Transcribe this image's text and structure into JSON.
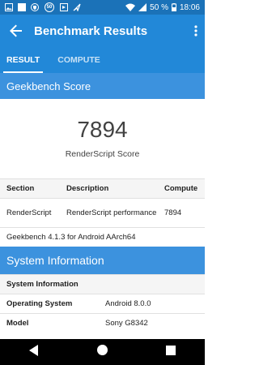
{
  "status_bar": {
    "battery": "50 %",
    "time": "18:06",
    "left_icons": [
      "image-icon",
      "square-icon",
      "shield-icon",
      "badge-50-icon",
      "media-icon",
      "send-icon"
    ],
    "badge_50": "50"
  },
  "toolbar": {
    "title": "Benchmark Results"
  },
  "tabs": [
    {
      "label": "RESULT",
      "active": true
    },
    {
      "label": "COMPUTE",
      "active": false
    }
  ],
  "geekbench": {
    "header": "Geekbench Score",
    "score": "7894",
    "score_label": "RenderScript Score"
  },
  "results_table": {
    "headers": [
      "Section",
      "Description",
      "Compute"
    ],
    "rows": [
      [
        "RenderScript",
        "RenderScript performance",
        "7894"
      ]
    ]
  },
  "version_text": "Geekbench 4.1.3 for Android AArch64",
  "system_information": {
    "header": "System Information",
    "subheader": "System Information",
    "rows": [
      {
        "key": "Operating System",
        "value": "Android 8.0.0"
      },
      {
        "key": "Model",
        "value": "Sony G8342"
      }
    ]
  },
  "colors": {
    "status_bar": "#1b72b8",
    "toolbar": "#2288d8",
    "section_header": "#3c92de"
  }
}
